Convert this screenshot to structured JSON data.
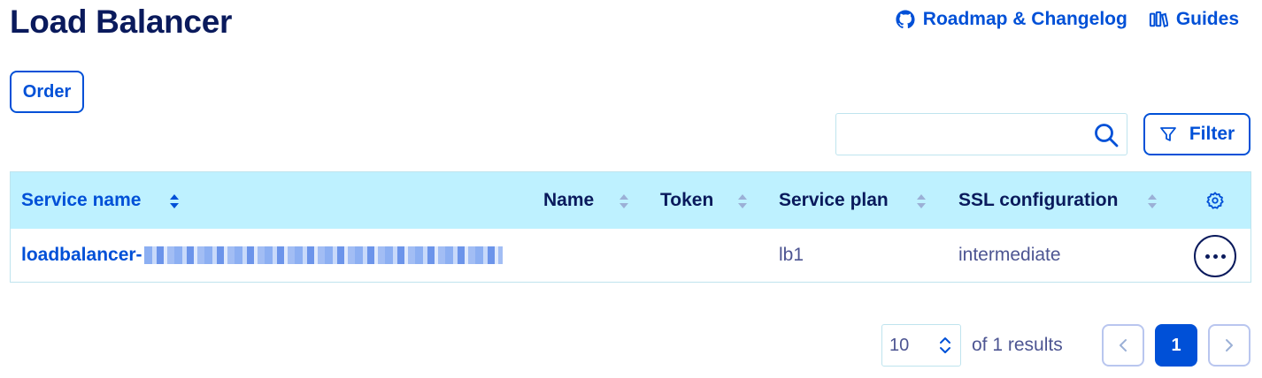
{
  "page": {
    "title": "Load Balancer"
  },
  "header_links": {
    "roadmap": {
      "label": "Roadmap & Changelog",
      "icon": "github-icon"
    },
    "guides": {
      "label": "Guides",
      "icon": "book-icon"
    }
  },
  "toolbar": {
    "order_label": "Order",
    "search_placeholder": "",
    "search_value": "",
    "filter_label": "Filter"
  },
  "table": {
    "columns": [
      {
        "key": "service_name",
        "label": "Service name",
        "sorted": "asc"
      },
      {
        "key": "name",
        "label": "Name"
      },
      {
        "key": "token",
        "label": "Token"
      },
      {
        "key": "service_plan",
        "label": "Service plan"
      },
      {
        "key": "ssl_configuration",
        "label": "SSL configuration"
      }
    ],
    "rows": [
      {
        "service_name": "loadbalancer-",
        "name": "",
        "token": "",
        "service_plan": "lb1",
        "ssl_configuration": "intermediate"
      }
    ]
  },
  "pagination": {
    "page_size": "10",
    "results_text": "of 1 results",
    "current_page": "1"
  },
  "colors": {
    "accent": "#0050d7",
    "title": "#0a1a5c",
    "header_bg": "#bef1ff",
    "border": "#bfe4ee",
    "muted_text": "#4d5592"
  }
}
